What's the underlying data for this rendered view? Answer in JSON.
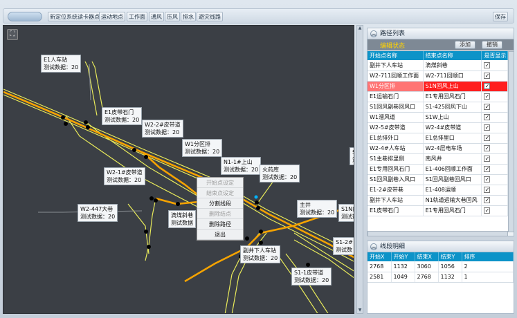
{
  "toolbar": {
    "buttons": [
      "新定位系统读卡器点",
      "运动地点",
      "工作面",
      "通风",
      "压风",
      "排水",
      "避灾线路"
    ],
    "save_label": "保存"
  },
  "map": {
    "labels": [
      {
        "name": "E1人车站",
        "data": "测试数据：20"
      },
      {
        "name": "E1皮带石门",
        "data": "测试数据：20"
      },
      {
        "name": "W2-2#皮带道",
        "data": "测试数据：20"
      },
      {
        "name": "W1分区排",
        "data": "测试数据：20"
      },
      {
        "name": "W2-1#皮带道",
        "data": "测试数据：20"
      },
      {
        "name": "N1-1#上山",
        "data": "测试数据：20"
      },
      {
        "name": "火药库",
        "data": "测试数据：20"
      },
      {
        "name": "W2-447大巷",
        "data": "测试数据：20"
      },
      {
        "name": "滴煤斜巷",
        "data": "测试数据"
      },
      {
        "name": "主井",
        "data": "测试数据：20"
      },
      {
        "name": "S1N内",
        "data": "测试数"
      },
      {
        "name": "副井下人车站",
        "data": "测试数据：20"
      },
      {
        "name": "S1-2#",
        "data": "测试数"
      },
      {
        "name": "S1-1皮带道",
        "data": "测试数据：20"
      },
      {
        "name": "S",
        "data": "测"
      }
    ],
    "context_menu": [
      "开始点设定",
      "结束点设定",
      "分割线段",
      "删除结点",
      "删除路径",
      "退出"
    ]
  },
  "path_panel": {
    "title": "路径列表",
    "edit_status": "编辑状态",
    "add_label": "添加",
    "delete_label": "撤销",
    "columns": [
      "开始点名称",
      "结束点名称",
      "是否显示"
    ],
    "rows": [
      [
        "副井下人车站",
        "滴煤斜巷",
        "✓"
      ],
      [
        "W2-711回顺工作面",
        "W2-711回顺口",
        "✓"
      ],
      [
        "W1分区排",
        "S1N回风上山",
        "✓"
      ],
      [
        "E1运输石门",
        "E1专用回风石门",
        "✓"
      ],
      [
        "S1回风副巷回风口",
        "S1-425回风下山",
        "✓"
      ],
      [
        "W1溜风道",
        "S1W上山",
        "✓"
      ],
      [
        "W2-5#皮带道",
        "W2-4#皮带道",
        "✓"
      ],
      [
        "E1总排外口",
        "E1总排里口",
        "✓"
      ],
      [
        "W2-4#人车站",
        "W2-4层电车场",
        "✓"
      ],
      [
        "S1主巷排里侧",
        "南风井",
        "✓"
      ],
      [
        "E1专用回风石门",
        "E1-406回顺工作面",
        "✓"
      ],
      [
        "S1回风副巷入风口",
        "S1回风副巷回风口",
        "✓"
      ],
      [
        "E1-2#皮带巷",
        "E1-408运顺",
        "✓"
      ],
      [
        "副井下人车站",
        "N1轨道运输大巷回风",
        "✓"
      ],
      [
        "E1皮带石门",
        "E1专用回风石门",
        "✓"
      ]
    ],
    "selected_row": 2
  },
  "segment_panel": {
    "title": "线段明细",
    "columns": [
      "开始X",
      "开始Y",
      "结束X",
      "结束Y",
      "排序"
    ],
    "rows": [
      [
        "2768",
        "1132",
        "3060",
        "1056",
        "2"
      ],
      [
        "2581",
        "1049",
        "2768",
        "1132",
        "1"
      ]
    ]
  },
  "colors": {
    "accent": "#0c93c8",
    "selected": "#ff1e1e",
    "route": "#f5a300",
    "tunnel": "#e8ea5a",
    "edit_status": "#ffd200"
  }
}
